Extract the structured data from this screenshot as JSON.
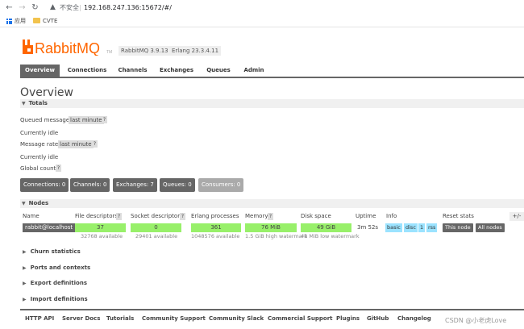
{
  "browser": {
    "insecure_label": "不安全",
    "url": "192.168.247.136:15672/#/",
    "bookmarks": [
      {
        "label": "应用"
      },
      {
        "label": "CVTE"
      }
    ]
  },
  "header": {
    "logo_text": "RabbitMQ",
    "logo_tm": "TM",
    "version": "RabbitMQ 3.9.13",
    "erlang": "Erlang 23.3.4.11"
  },
  "tabs": [
    "Overview",
    "Connections",
    "Channels",
    "Exchanges",
    "Queues",
    "Admin"
  ],
  "page_title": "Overview",
  "totals": {
    "heading": "Totals",
    "queued_messages_label": "Queued messages",
    "queued_interval": "last minute",
    "currently_idle_1": "Currently idle",
    "message_rates_label": "Message rates",
    "rates_interval": "last minute",
    "currently_idle_2": "Currently idle",
    "global_counts_label": "Global counts",
    "help": "?"
  },
  "counts": [
    {
      "label": "Connections: 0"
    },
    {
      "label": "Channels: 0"
    },
    {
      "label": "Exchanges: 7"
    },
    {
      "label": "Queues: 0"
    },
    {
      "label": "Consumers: 0"
    }
  ],
  "nodes": {
    "heading": "Nodes",
    "columns": {
      "name": "Name",
      "fd": "File descriptors",
      "sd": "Socket descriptors",
      "ep": "Erlang processes",
      "mem": "Memory",
      "disk": "Disk space",
      "uptime": "Uptime",
      "info": "Info",
      "reset": "Reset stats"
    },
    "plusminus": "+/-",
    "row": {
      "name": "rabbit@localhost",
      "fd_value": "37",
      "fd_available": "32768 available",
      "sd_value": "0",
      "sd_available": "29401 available",
      "ep_value": "361",
      "ep_available": "1048576 available",
      "mem_value": "76 MiB",
      "mem_watermark": "1.5 GiB high watermark",
      "disk_value": "49 GiB",
      "disk_watermark": "48 MiB low watermark",
      "uptime": "3m 52s",
      "info_tags": [
        "basic",
        "disc",
        "1",
        "rss"
      ],
      "reset_this": "This node",
      "reset_all": "All nodes"
    }
  },
  "collapsed_sections": [
    "Churn statistics",
    "Ports and contexts",
    "Export definitions",
    "Import definitions"
  ],
  "footer_links": [
    "HTTP API",
    "Server Docs",
    "Tutorials",
    "Community Support",
    "Community Slack",
    "Commercial Support",
    "Plugins",
    "GitHub",
    "Changelog"
  ],
  "watermark": "CSDN @小老虎Love",
  "colors": {
    "brand_orange": "#f60",
    "tab_active": "#666666",
    "bar_green": "#98f06a",
    "info_blue": "#9be3ff"
  }
}
